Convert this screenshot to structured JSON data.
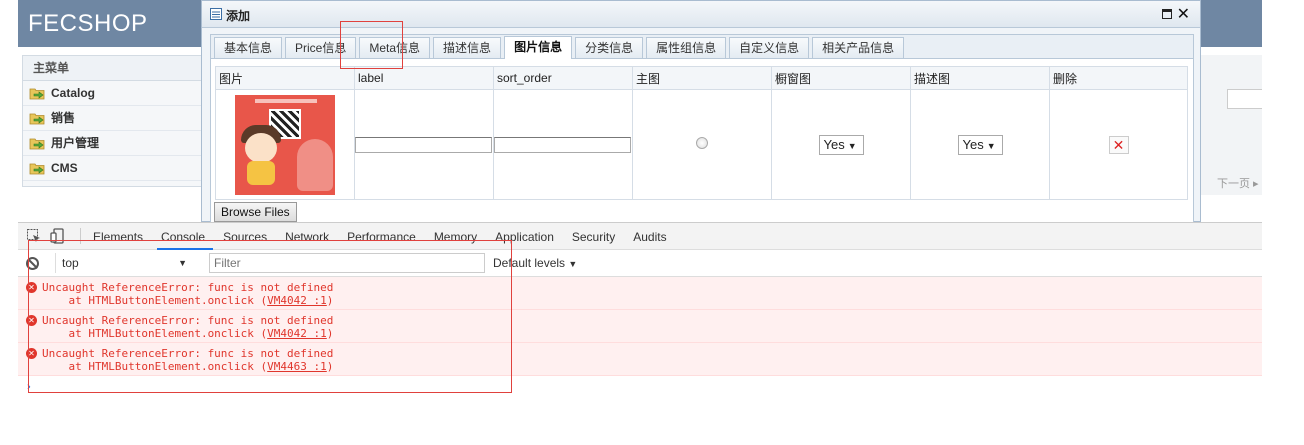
{
  "app": {
    "logo": "FECSHOP"
  },
  "sidebar": {
    "title": "主菜单",
    "items": [
      {
        "label": "Catalog",
        "icon": "folder-arrow-icon"
      },
      {
        "label": "销售",
        "icon": "folder-arrow-icon"
      },
      {
        "label": "用户管理",
        "icon": "folder-arrow-icon"
      },
      {
        "label": "CMS",
        "icon": "folder-arrow-icon"
      }
    ]
  },
  "background": {
    "pager_text": "下一页 ▸ 末"
  },
  "dialog": {
    "title": "添加",
    "tabs": [
      {
        "label": "基本信息",
        "active": false
      },
      {
        "label": "Price信息",
        "active": false
      },
      {
        "label": "Meta信息",
        "active": false
      },
      {
        "label": "描述信息",
        "active": false
      },
      {
        "label": "图片信息",
        "active": true
      },
      {
        "label": "分类信息",
        "active": false
      },
      {
        "label": "属性组信息",
        "active": false
      },
      {
        "label": "自定义信息",
        "active": false
      },
      {
        "label": "相关产品信息",
        "active": false
      }
    ],
    "table": {
      "columns": [
        "图片",
        "label",
        "sort_order",
        "主图",
        "橱窗图",
        "描述图",
        "删除"
      ],
      "row": {
        "label_value": "",
        "sort_order_value": "",
        "is_main": false,
        "showcase": "Yes",
        "description": "Yes",
        "delete_symbol": "✕"
      }
    },
    "browse_label": "Browse Files"
  },
  "devtools": {
    "tabs": [
      {
        "label": "Elements",
        "active": false
      },
      {
        "label": "Console",
        "active": true
      },
      {
        "label": "Sources",
        "active": false
      },
      {
        "label": "Network",
        "active": false
      },
      {
        "label": "Performance",
        "active": false
      },
      {
        "label": "Memory",
        "active": false
      },
      {
        "label": "Application",
        "active": false
      },
      {
        "label": "Security",
        "active": false
      },
      {
        "label": "Audits",
        "active": false
      }
    ],
    "context": "top",
    "filter_placeholder": "Filter",
    "levels": "Default levels",
    "errors": [
      {
        "message": "Uncaught ReferenceError: func is not defined",
        "stack_prefix": "    at HTMLButtonElement.onclick (",
        "link": "VM4042 :1",
        "stack_suffix": ")"
      },
      {
        "message": "Uncaught ReferenceError: func is not defined",
        "stack_prefix": "    at HTMLButtonElement.onclick (",
        "link": "VM4042 :1",
        "stack_suffix": ")"
      },
      {
        "message": "Uncaught ReferenceError: func is not defined",
        "stack_prefix": "    at HTMLButtonElement.onclick (",
        "link": "VM4463 :1",
        "stack_suffix": ")"
      }
    ],
    "prompt_symbol": "›"
  },
  "colors": {
    "header": "#6f87a3",
    "error_text": "#e0362c",
    "error_bg": "#fff0f0",
    "highlight_box": "#e0413d",
    "devtools_accent": "#1a73e8"
  }
}
